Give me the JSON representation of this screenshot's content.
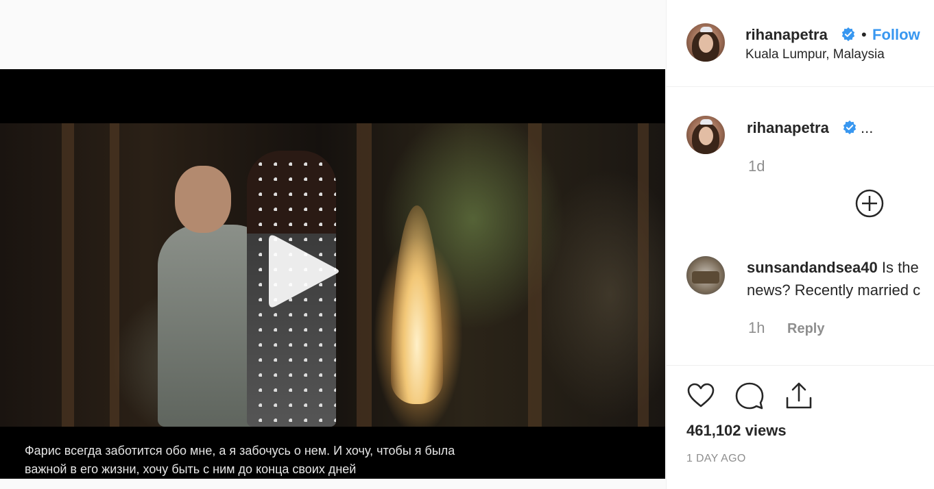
{
  "post": {
    "author": "rihanapetra",
    "follow_separator": "•",
    "follow_label": "Follow",
    "location": "Kuala Lumpur, Malaysia"
  },
  "video": {
    "subtitle": "Фарис всегда заботится обо мне, а я забочусь о нем. И хочу, чтобы я была\nважной в его жизни, хочу быть с ним до конца своих дней"
  },
  "caption": {
    "author": "rihanapetra",
    "truncated": "...",
    "time": "1d"
  },
  "comments": [
    {
      "user": "sunsandandsea40",
      "text_line1": "Is the",
      "text_line2": "news? Recently married c",
      "time": "1h",
      "reply_label": "Reply"
    }
  ],
  "stats": {
    "views": "461,102 views",
    "posted": "1 DAY AGO"
  },
  "icons": {
    "verified": "verified-badge-icon",
    "play": "play-icon",
    "plus": "load-more-plus-icon",
    "like": "heart-icon",
    "comment": "comment-bubble-icon",
    "share": "share-upload-icon"
  },
  "colors": {
    "link_blue": "#3897f0",
    "muted_gray": "#8e8e8e",
    "text": "#262626"
  }
}
